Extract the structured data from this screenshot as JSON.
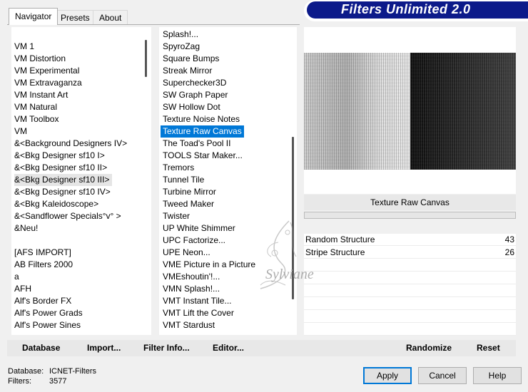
{
  "tabs": [
    {
      "label": "Navigator",
      "active": true
    },
    {
      "label": "Presets",
      "active": false
    },
    {
      "label": "About",
      "active": false
    }
  ],
  "banner": {
    "title": "Filters Unlimited 2.0",
    "color": "#0c1a8a"
  },
  "categories": [
    "VM 1",
    "VM Distortion",
    "VM Experimental",
    "VM Extravaganza",
    "VM Instant Art",
    "VM Natural",
    "VM Toolbox",
    "VM",
    "&<Background Designers IV>",
    "&<Bkg Designer sf10 I>",
    "&<Bkg Designer sf10 II>",
    "&<Bkg Designer sf10 III>",
    "&<Bkg Designer sf10 IV>",
    "&<Bkg Kaleidoscope>",
    "&<Sandflower Specials°v° >",
    "&Neu!",
    "",
    "[AFS IMPORT]",
    "AB Filters 2000",
    "a",
    "AFH",
    "Alf's Border FX",
    "Alf's Power Grads",
    "Alf's Power Sines"
  ],
  "categories_highlighted_index": 11,
  "filters": [
    "Splash!...",
    "SpyroZag",
    "Square Bumps",
    "Streak Mirror",
    "Superchecker3D",
    "SW Graph Paper",
    "SW Hollow Dot",
    "Texture Noise Notes",
    "Texture Raw Canvas",
    "The Toad's Pool II",
    "TOOLS Star Maker...",
    "Tremors",
    "Tunnel Tile",
    "Turbine Mirror",
    "Tweed Maker",
    "Twister",
    "UP White Shimmer",
    "UPC Factorize...",
    "UPE Neon...",
    "VME Picture in a Picture",
    "VMEshoutin'!...",
    "VMN Splash!...",
    "VMT Instant Tile...",
    "VMT Lift the Cover",
    "VMT Stardust"
  ],
  "filters_selected_index": 8,
  "selected_filter_name": "Texture Raw Canvas",
  "params": [
    {
      "label": "Random Structure",
      "value": "43"
    },
    {
      "label": "Stripe Structure",
      "value": "26"
    }
  ],
  "bottom_links": {
    "database": "Database",
    "import": "Import...",
    "filter_info": "Filter Info...",
    "editor": "Editor...",
    "randomize": "Randomize",
    "reset": "Reset"
  },
  "status": {
    "database_label": "Database:",
    "database_value": "ICNET-Filters",
    "filters_label": "Filters:",
    "filters_value": "3577"
  },
  "buttons": {
    "apply": "Apply",
    "cancel": "Cancel",
    "help": "Help"
  },
  "watermark": "Sylviane",
  "colors": {
    "selection": "#0078d7",
    "default_button_border": "#0078d7"
  }
}
